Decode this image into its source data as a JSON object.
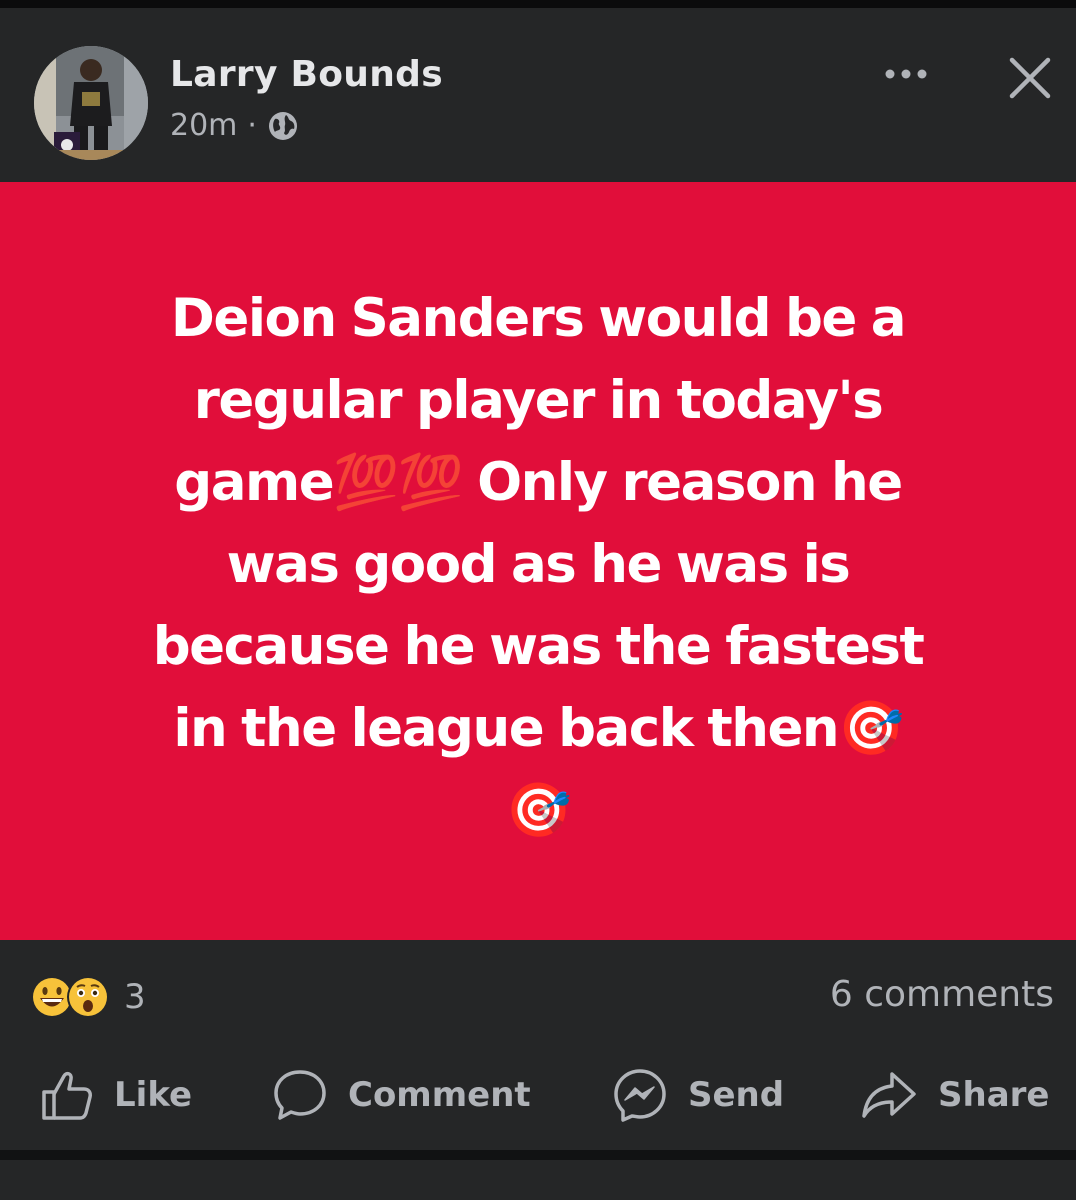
{
  "post": {
    "author_name": "Larry Bounds",
    "time_ago": "20m",
    "separator": "·",
    "privacy_icon": "globe-icon",
    "more_icon": "more-dots-icon",
    "close_icon": "close-icon",
    "background_color": "#e10e3a",
    "text": "Deion Sanders would be a\nregular player in today's\ngame💯💯 Only reason he\nwas good as he was is\nbecause he was the fastest\nin the league back then🎯\n🎯"
  },
  "reactions": {
    "icons": [
      "grinning-face-icon",
      "surprised-face-icon"
    ],
    "count": "3"
  },
  "comments": {
    "label": "6 comments"
  },
  "actions": {
    "like": {
      "label": "Like",
      "icon": "thumbs-up-icon"
    },
    "comment": {
      "label": "Comment",
      "icon": "speech-bubble-icon"
    },
    "send": {
      "label": "Send",
      "icon": "messenger-icon"
    },
    "share": {
      "label": "Share",
      "icon": "share-arrow-icon"
    }
  }
}
